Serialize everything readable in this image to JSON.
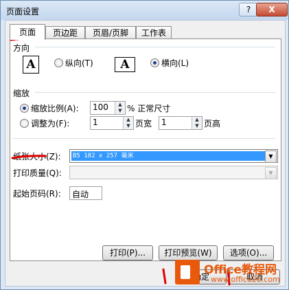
{
  "window": {
    "title": "页面设置",
    "help_label": "?",
    "close_label": "X"
  },
  "tabs": [
    {
      "label": "页面",
      "active": true
    },
    {
      "label": "页边距",
      "active": false
    },
    {
      "label": "页眉/页脚",
      "active": false
    },
    {
      "label": "工作表",
      "active": false
    }
  ],
  "orientation": {
    "heading": "方向",
    "portrait_label": "纵向(T)",
    "landscape_label": "横向(L)",
    "selected": "landscape",
    "icon_letter": "A"
  },
  "scaling": {
    "heading": "缩放",
    "adjust_to_label": "缩放比例(A):",
    "adjust_to_value": "100",
    "percent_label": "% 正常尺寸",
    "fit_to_label": "调整为(F):",
    "pages_wide_value": "1",
    "pages_wide_label": "页宽",
    "pages_tall_value": "1",
    "pages_tall_label": "页高",
    "selected": "adjust"
  },
  "paper_size": {
    "label": "纸张大小(Z):",
    "value": "B5 182 x 257 毫米"
  },
  "print_quality": {
    "label": "打印质量(Q):",
    "value": ""
  },
  "first_page_number": {
    "label": "起始页码(R):",
    "value": "自动"
  },
  "buttons": {
    "print": "打印(P)...",
    "preview": "打印预览(W)",
    "options": "选项(O)...",
    "ok": "确定",
    "cancel": "取消"
  },
  "watermark": {
    "brand": "Office教程网",
    "url": "www.office26.com"
  },
  "colors": {
    "annotation_red": "#e00000",
    "accent_orange": "#e8590c",
    "selection_blue": "#3399ff"
  }
}
